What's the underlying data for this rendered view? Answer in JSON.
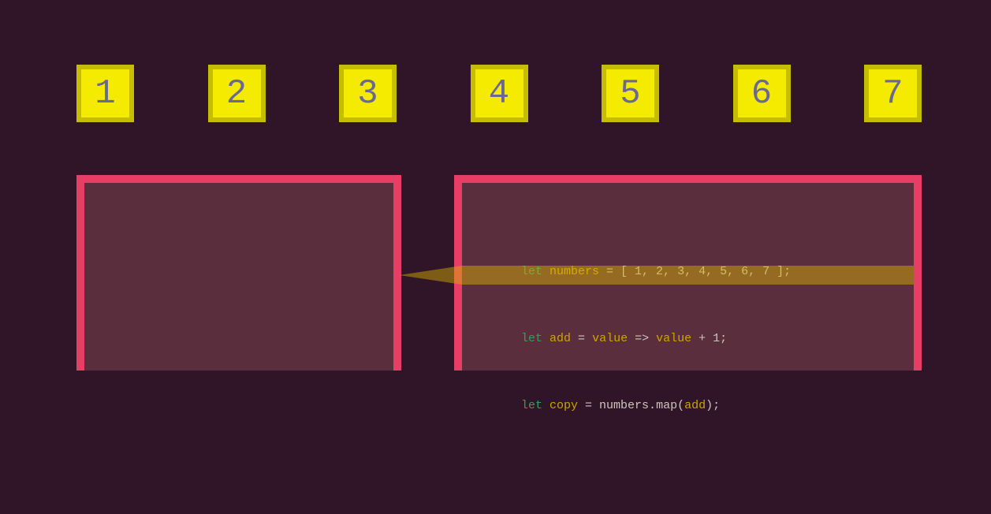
{
  "numbers": [
    "1",
    "2",
    "3",
    "4",
    "5",
    "6",
    "7"
  ],
  "code": {
    "line1": {
      "let": "let",
      "ident": "numbers",
      "rest": " = [ 1, 2, 3, 4, 5, 6, 7 ];"
    },
    "line2": {
      "let": "let",
      "ident": "add",
      "eq": " = ",
      "param": "value",
      "arrow": " => ",
      "param2": "value",
      "rest": " + 1;"
    },
    "line3": {
      "let": "let",
      "ident": "copy",
      "mid": " = numbers.map(",
      "fn": "add",
      "close": ");"
    }
  },
  "colors": {
    "bg": "#301528",
    "box_fill": "#f5eb00",
    "box_border": "#c5bd00",
    "box_text": "#6a6895",
    "panel_fill": "#5b2e3e",
    "panel_border": "#e83e65",
    "highlight": "rgba(220,180,0,0.45)",
    "kw": "#3a9c58",
    "ident": "#cca300",
    "text": "#ccc6b8"
  }
}
